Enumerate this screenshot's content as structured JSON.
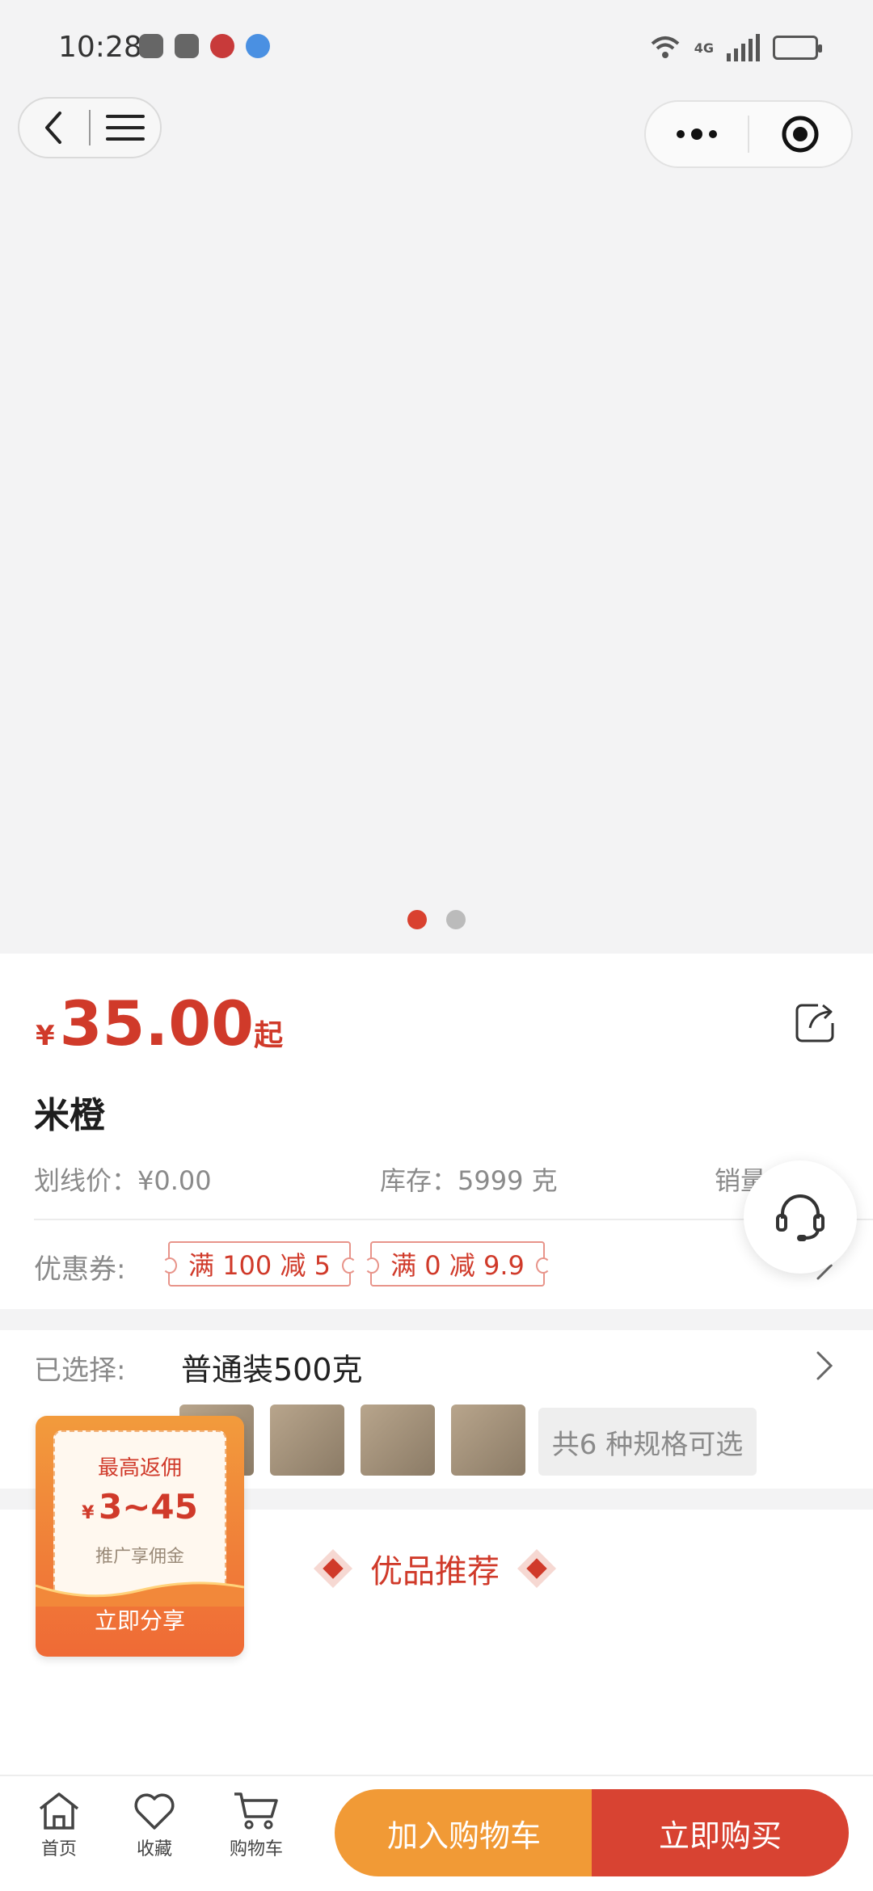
{
  "status_bar": {
    "time": "10:28",
    "network": "4G"
  },
  "carousel": {
    "pages": 2,
    "active_index": 0
  },
  "product": {
    "currency": "¥",
    "price": "35.00",
    "price_suffix": "起",
    "name": "米橙",
    "list_price_label": "划线价：",
    "list_price": "¥0.00",
    "stock_label": "库存：",
    "stock": "5999 克",
    "sales_label": "销量"
  },
  "coupons": {
    "label": "优惠券:",
    "items": [
      "满 100 减 5",
      "满 0 减 9.9"
    ]
  },
  "selection": {
    "label": "已选择:",
    "value": "普通装500克",
    "spec_count": "共6 种规格可选"
  },
  "recommend": {
    "title": "优品推荐"
  },
  "promo": {
    "title": "最高返佣",
    "currency": "¥",
    "amount": "3~45",
    "subtitle": "推广享佣金",
    "button": "立即分享"
  },
  "bottom_bar": {
    "home": "首页",
    "favorite": "收藏",
    "cart": "购物车",
    "add_to_cart": "加入购物车",
    "buy_now": "立即购买"
  },
  "colors": {
    "accent_red": "#d03a2a",
    "orange": "#f19a36",
    "buy_red": "#d84332"
  }
}
